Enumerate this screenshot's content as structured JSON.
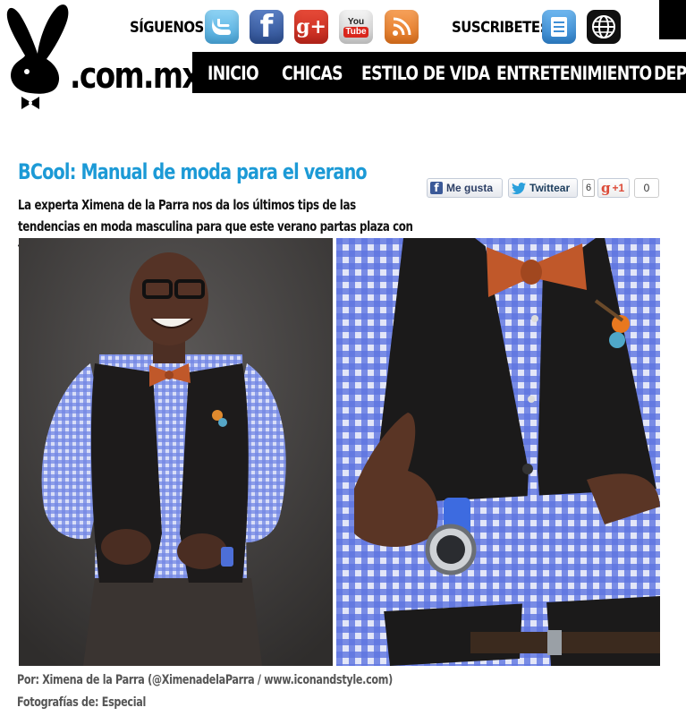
{
  "site": {
    "logo_text": ".com.mx"
  },
  "header": {
    "follow_label": "SÍGUENOS:",
    "subscribe_label": "SUSCRIBETE:",
    "social_icons": [
      "twitter-icon",
      "facebook-icon",
      "google-plus-icon",
      "youtube-icon",
      "rss-icon"
    ],
    "subscribe_icons": [
      "newsletter-icon",
      "web-icon"
    ],
    "gplus_text": "g+",
    "facebook_text": "f",
    "youtube_top": "You",
    "youtube_bottom": "Tube"
  },
  "nav": {
    "items": [
      {
        "label": "INICIO"
      },
      {
        "label": "CHICAS"
      },
      {
        "label": "ESTILO DE VIDA"
      },
      {
        "label": "ENTRETENIMIENTO"
      },
      {
        "label": "DEPORTES"
      }
    ]
  },
  "article": {
    "title": "BCool: Manual de moda para el verano",
    "subtitle": "La experta Ximena de la Parra nos da los últimos tips de las tendencias en moda masculina para que este verano partas plaza con tu estilo...",
    "credit_author": "Por: Ximena de la Parra (@XimenadelaParra / www.iconandstyle.com)",
    "credit_photos": "Fotografías de: Especial"
  },
  "share": {
    "like_label": "Me gusta",
    "tweet_label": "Twittear",
    "tweet_count": "6",
    "gplus_label": "+1",
    "gplus_count": "0"
  },
  "colors": {
    "title_blue": "#1c9ad6",
    "nav_bg": "#000000",
    "shirt_blue": "#6a7fe0",
    "bowtie_orange": "#c0582a"
  }
}
